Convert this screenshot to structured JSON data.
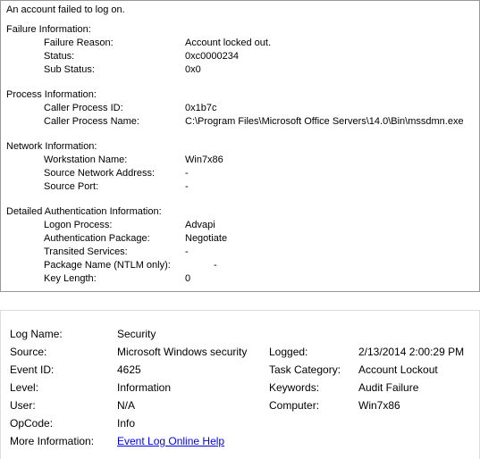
{
  "header": "An account failed to log on.",
  "sections": {
    "failure": {
      "title": "Failure Information:",
      "reason_label": "Failure Reason:",
      "reason_value": "Account locked out.",
      "status_label": "Status:",
      "status_value": "0xc0000234",
      "substatus_label": "Sub Status:",
      "substatus_value": "0x0"
    },
    "process": {
      "title": "Process Information:",
      "pid_label": "Caller Process ID:",
      "pid_value": "0x1b7c",
      "pname_label": "Caller Process Name:",
      "pname_value": "C:\\Program Files\\Microsoft Office Servers\\14.0\\Bin\\mssdmn.exe"
    },
    "network": {
      "title": "Network Information:",
      "ws_label": "Workstation Name:",
      "ws_value": "Win7x86",
      "addr_label": "Source Network Address:",
      "addr_value": "-",
      "port_label": "Source Port:",
      "port_value": "-"
    },
    "auth": {
      "title": "Detailed Authentication Information:",
      "logon_label": "Logon Process:",
      "logon_value": "Advapi",
      "pkg_label": "Authentication Package:",
      "pkg_value": "Negotiate",
      "trans_label": "Transited Services:",
      "trans_value": "-",
      "ntlm_label": "Package Name (NTLM only):",
      "ntlm_value": "-",
      "keylen_label": "Key Length:",
      "keylen_value": "0"
    }
  },
  "meta": {
    "logname_label": "Log Name:",
    "logname_value": "Security",
    "source_label": "Source:",
    "source_value": "Microsoft Windows security",
    "logged_label": "Logged:",
    "logged_value": "2/13/2014 2:00:29 PM",
    "eventid_label": "Event ID:",
    "eventid_value": "4625",
    "taskcat_label": "Task Category:",
    "taskcat_value": "Account Lockout",
    "level_label": "Level:",
    "level_value": "Information",
    "keywords_label": "Keywords:",
    "keywords_value": "Audit Failure",
    "user_label": "User:",
    "user_value": "N/A",
    "computer_label": "Computer:",
    "computer_value": "Win7x86",
    "opcode_label": "OpCode:",
    "opcode_value": "Info",
    "moreinfo_label": "More Information:",
    "moreinfo_link": "Event Log Online Help"
  }
}
